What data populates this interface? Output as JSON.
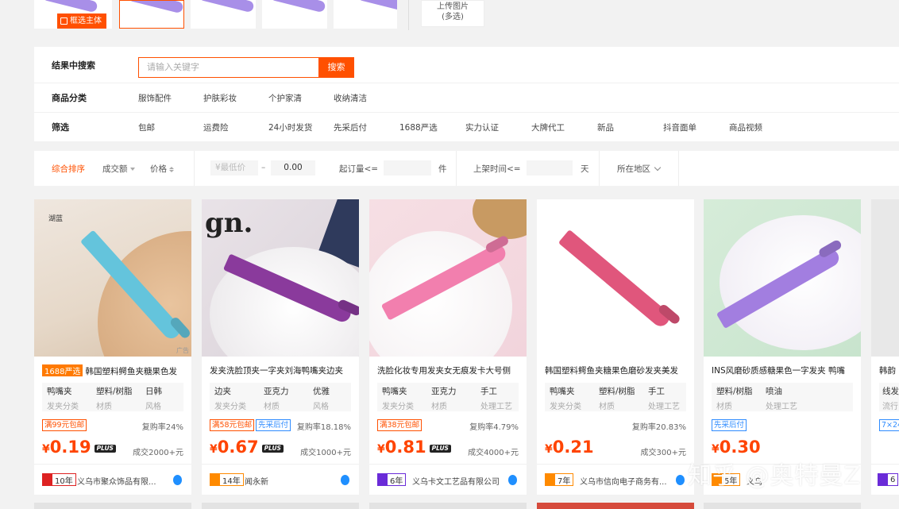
{
  "top": {
    "frame_button": "框选主体",
    "upload_line1": "上传图片",
    "upload_line2": "(多选)"
  },
  "filters": {
    "search_label": "结果中搜索",
    "search_placeholder": "请输入关键字",
    "search_button": "搜索",
    "category_label": "商品分类",
    "categories": [
      "服饰配件",
      "护肤彩妆",
      "个护家清",
      "收纳清洁"
    ],
    "screen_label": "筛选",
    "screens": [
      "包邮",
      "运费险",
      "24小时发货",
      "先采后付",
      "1688严选",
      "实力认证",
      "大牌代工",
      "新品",
      "抖音面单",
      "商品视频"
    ]
  },
  "sort": {
    "comprehensive": "综合排序",
    "sales": "成交额",
    "price": "价格",
    "min_price_placeholder": "¥最低价",
    "dash": "–",
    "max_price": "0.00",
    "min_order": "起订量<=",
    "unit": "件",
    "listed": "上架时间<=",
    "days": "天",
    "region": "所在地区"
  },
  "colors": {
    "accent": "#ff5000",
    "price": "#ff4400"
  },
  "products": [
    {
      "badge": "1688严选",
      "image_label": "湖蓝",
      "ad": "广告",
      "title": "韩国塑料鳄鱼夹糖果色发",
      "attrs": [
        [
          "鸭嘴夹",
          "发夹分类"
        ],
        [
          "塑料/树脂",
          "材质"
        ],
        [
          "日韩",
          "风格"
        ]
      ],
      "tags": [
        "满99元包邮"
      ],
      "repurchase": "复购率24%",
      "price": "0.19",
      "plus": "PLUS",
      "sold": "成交2000+元",
      "years": "10年",
      "shop": "义乌市聚众饰品有限...",
      "clip_color": "#64c4dc"
    },
    {
      "badge": "",
      "image_label": "gn.",
      "ad": "",
      "title": "发夹洗脸顶夹一字夹刘海鸭嘴夹边夹",
      "attrs": [
        [
          "边夹",
          "发夹分类"
        ],
        [
          "亚克力",
          "材质"
        ],
        [
          "优雅",
          "风格"
        ]
      ],
      "tags": [
        "满58元包邮",
        "先采后付"
      ],
      "repurchase": "复购率18.18%",
      "price": "0.67",
      "plus": "PLUS",
      "sold": "成交1000+元",
      "years": "14年",
      "shop": "闻永新",
      "clip_color": "#8a3a9c"
    },
    {
      "badge": "",
      "image_label": "",
      "ad": "",
      "title": "洗脸化妆专用发夹女无痕发卡大号侧",
      "attrs": [
        [
          "鸭嘴夹",
          "发夹分类"
        ],
        [
          "亚克力",
          "材质"
        ],
        [
          "手工",
          "处理工艺"
        ]
      ],
      "tags": [
        "满38元包邮"
      ],
      "repurchase": "复购率4.79%",
      "price": "0.81",
      "plus": "PLUS",
      "sold": "成交4000+元",
      "years": "6年",
      "shop": "义乌卡文工艺品有限公司",
      "clip_color": "#f27fae"
    },
    {
      "badge": "",
      "image_label": "",
      "ad": "",
      "title": "韩国塑料鳄鱼夹糖果色磨砂发夹美发",
      "attrs": [
        [
          "鸭嘴夹",
          "发夹分类"
        ],
        [
          "塑料/树脂",
          "材质"
        ],
        [
          "手工",
          "处理工艺"
        ]
      ],
      "tags": [],
      "repurchase": "复购率20.83%",
      "price": "0.21",
      "plus": "",
      "sold": "成交300+元",
      "years": "7年",
      "shop": "义乌市信向电子商务有...",
      "clip_color": "#e0567c"
    },
    {
      "badge": "",
      "image_label": "",
      "ad": "",
      "title": "INS风磨砂质感糖果色一字发夹 鸭嘴",
      "attrs": [
        [
          "",
          ""
        ],
        [
          "塑料/树脂",
          "材质"
        ],
        [
          "喷油",
          "处理工艺"
        ]
      ],
      "tags": [
        "先采后付"
      ],
      "repurchase": "",
      "price": "0.30",
      "plus": "",
      "sold": "",
      "years": "5年",
      "shop": "义乌",
      "clip_color": "#a27ee0"
    }
  ],
  "partial_card": {
    "title": "韩韵",
    "attr": "线发",
    "attr_k": "流行",
    "tag": "7×24",
    "years": "6"
  },
  "watermark": "知乎 @奥特曼Z"
}
